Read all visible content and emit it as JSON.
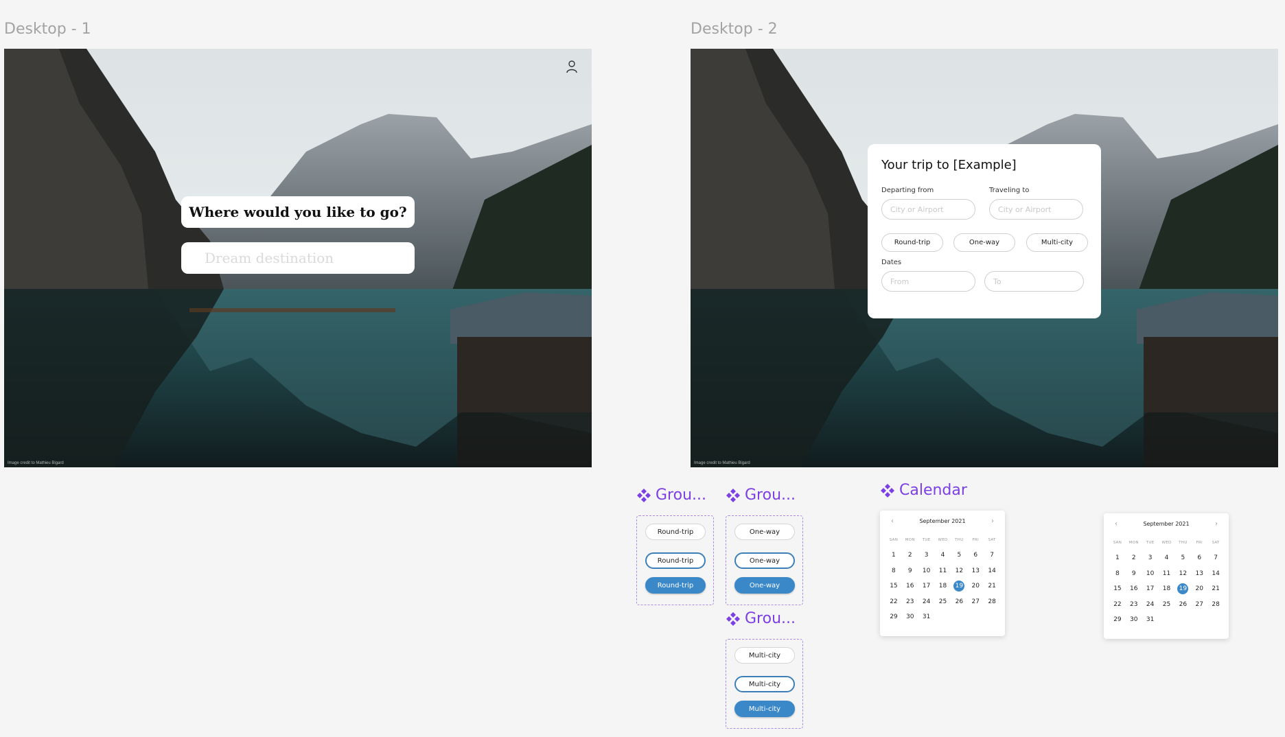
{
  "frames": {
    "desktop1_label": "Desktop - 1",
    "desktop2_label": "Desktop - 2"
  },
  "credit": "Image credit to Mathieu Bigard",
  "desktop1": {
    "question": "Where would you like to go?",
    "destination_placeholder": "Dream destination",
    "user_icon": "user-icon"
  },
  "desktop2": {
    "title": "Your trip to [Example]",
    "departing_label": "Departing from",
    "traveling_label": "Traveling to",
    "city_placeholder": "City or Airport",
    "round_trip": "Round-trip",
    "one_way": "One-way",
    "multi_city": "Multi-city",
    "dates_label": "Dates",
    "from_placeholder": "From",
    "to_placeholder": "To"
  },
  "components": {
    "group_title": "Grou...",
    "calendar_title": "Calendar",
    "round_trip": "Round-trip",
    "one_way": "One-way",
    "multi_city": "Multi-city",
    "component_icon": "component-diamond-icon",
    "accent": "#7b3fe4",
    "button_blue": "#3b88c9"
  },
  "calendar": {
    "month": "September 2021",
    "prev_icon": "chevron-left-icon",
    "next_icon": "chevron-right-icon",
    "weekdays": [
      "SAN",
      "MON",
      "TUE",
      "WED",
      "THU",
      "FRI",
      "SAT"
    ],
    "selected": "19",
    "weeks": [
      [
        "1",
        "2",
        "3",
        "4",
        "5",
        "6",
        "7"
      ],
      [
        "8",
        "9",
        "10",
        "11",
        "12",
        "13",
        "14"
      ],
      [
        "15",
        "16",
        "17",
        "18",
        "19",
        "20",
        "21"
      ],
      [
        "22",
        "23",
        "24",
        "25",
        "26",
        "27",
        "28"
      ],
      [
        "29",
        "30",
        "31",
        "",
        "",
        "",
        ""
      ]
    ]
  }
}
